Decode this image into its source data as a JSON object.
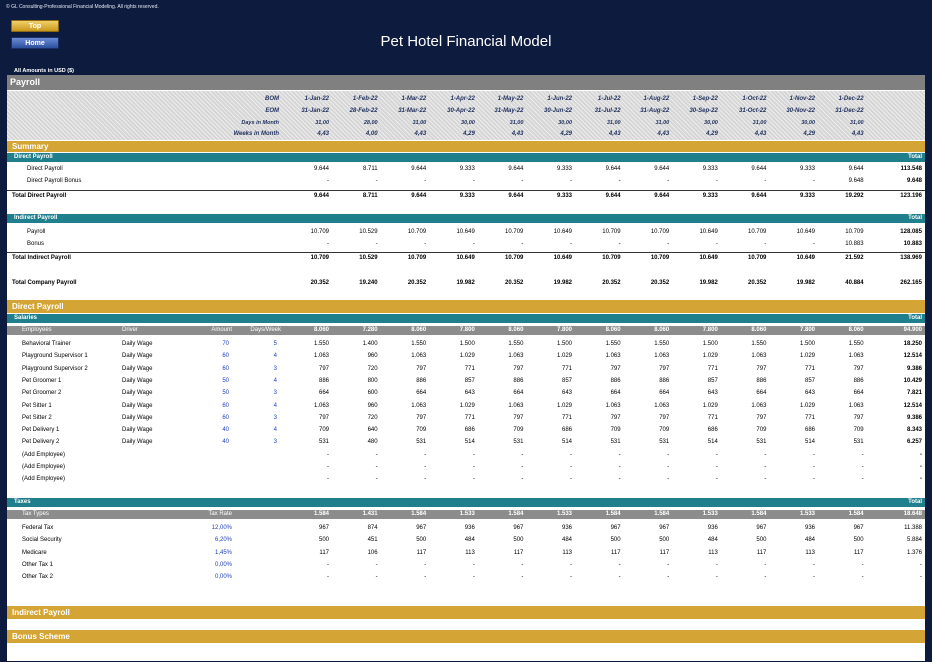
{
  "header": {
    "copyright": "© GL Consulting-Professional Financial Modeling. All rights reserved.",
    "top_button": "Top",
    "home_button": "Home",
    "title": "Pet Hotel Financial Model",
    "amounts": "All Amounts in  USD ($)"
  },
  "section_title": "Payroll",
  "timeline": {
    "bom_label": "BOM",
    "eom_label": "EOM",
    "days_label": "Days in Month",
    "weeks_label": "Weeks in Month",
    "bom": [
      "1-Jan-22",
      "1-Feb-22",
      "1-Mar-22",
      "1-Apr-22",
      "1-May-22",
      "1-Jun-22",
      "1-Jul-22",
      "1-Aug-22",
      "1-Sep-22",
      "1-Oct-22",
      "1-Nov-22",
      "1-Dec-22"
    ],
    "eom": [
      "31-Jan-22",
      "28-Feb-22",
      "31-Mar-22",
      "30-Apr-22",
      "31-May-22",
      "30-Jun-22",
      "31-Jul-22",
      "31-Aug-22",
      "30-Sep-22",
      "31-Oct-22",
      "30-Nov-22",
      "31-Dec-22"
    ],
    "days": [
      "31,00",
      "28,00",
      "31,00",
      "30,00",
      "31,00",
      "30,00",
      "31,00",
      "31,00",
      "30,00",
      "31,00",
      "30,00",
      "31,00"
    ],
    "weeks": [
      "4,43",
      "4,00",
      "4,43",
      "4,29",
      "4,43",
      "4,29",
      "4,43",
      "4,43",
      "4,29",
      "4,43",
      "4,29",
      "4,43"
    ]
  },
  "summary": {
    "title": "Summary",
    "direct_title": "Direct Payroll",
    "total_label": "Total",
    "direct_rows": [
      {
        "label": "Direct Payroll",
        "values": [
          "9.644",
          "8.711",
          "9.644",
          "9.333",
          "9.644",
          "9.333",
          "9.644",
          "9.644",
          "9.333",
          "9.644",
          "9.333",
          "9.644"
        ],
        "total": "113.548"
      },
      {
        "label": "Direct Payroll Bonus",
        "values": [
          "-",
          "-",
          "-",
          "-",
          "-",
          "-",
          "-",
          "-",
          "-",
          "-",
          "-",
          "9.648"
        ],
        "total": "9.648"
      }
    ],
    "direct_total": {
      "label": "Total Direct Payroll",
      "values": [
        "9.644",
        "8.711",
        "9.644",
        "9.333",
        "9.644",
        "9.333",
        "9.644",
        "9.644",
        "9.333",
        "9.644",
        "9.333",
        "19.292"
      ],
      "total": "123.196"
    },
    "indirect_title": "Indirect Payroll",
    "indirect_rows": [
      {
        "label": "Payroll",
        "values": [
          "10.709",
          "10.529",
          "10.709",
          "10.649",
          "10.709",
          "10.649",
          "10.709",
          "10.709",
          "10.649",
          "10.709",
          "10.649",
          "10.709"
        ],
        "total": "128.085"
      },
      {
        "label": "Bonus",
        "values": [
          "-",
          "-",
          "-",
          "-",
          "-",
          "-",
          "-",
          "-",
          "-",
          "-",
          "-",
          "10.883"
        ],
        "total": "10.883"
      }
    ],
    "indirect_total": {
      "label": "Total Indirect Payroll",
      "values": [
        "10.709",
        "10.529",
        "10.709",
        "10.649",
        "10.709",
        "10.649",
        "10.709",
        "10.709",
        "10.649",
        "10.709",
        "10.649",
        "21.592"
      ],
      "total": "138.969"
    },
    "company_total": {
      "label": "Total Company Payroll",
      "values": [
        "20.352",
        "19.240",
        "20.352",
        "19.982",
        "20.352",
        "19.982",
        "20.352",
        "20.352",
        "19.982",
        "20.352",
        "19.982",
        "40.884"
      ],
      "total": "262.165"
    }
  },
  "direct_payroll": {
    "title": "Direct Payroll",
    "salaries_title": "Salaries",
    "total_label": "Total",
    "columns": {
      "employees": "Employees",
      "driver": "Driver",
      "amount": "Amount",
      "days_week": "Days/Week"
    },
    "header_values": [
      "8.060",
      "7.280",
      "8.060",
      "7.800",
      "8.060",
      "7.800",
      "8.060",
      "8.060",
      "7.800",
      "8.060",
      "7.800",
      "8.060"
    ],
    "header_total": "94.900",
    "employees": [
      {
        "name": "Behavioral Trainer",
        "driver": "Daily Wage",
        "amount": "70",
        "days": "5",
        "values": [
          "1.550",
          "1.400",
          "1.550",
          "1.500",
          "1.550",
          "1.500",
          "1.550",
          "1.550",
          "1.500",
          "1.550",
          "1.500",
          "1.550"
        ],
        "total": "18.250"
      },
      {
        "name": "Playground Supervisor 1",
        "driver": "Daily Wage",
        "amount": "60",
        "days": "4",
        "values": [
          "1.063",
          "960",
          "1.063",
          "1.029",
          "1.063",
          "1.029",
          "1.063",
          "1.063",
          "1.029",
          "1.063",
          "1.029",
          "1.063"
        ],
        "total": "12.514"
      },
      {
        "name": "Playground Supervisor 2",
        "driver": "Daily Wage",
        "amount": "60",
        "days": "3",
        "values": [
          "797",
          "720",
          "797",
          "771",
          "797",
          "771",
          "797",
          "797",
          "771",
          "797",
          "771",
          "797"
        ],
        "total": "9.386"
      },
      {
        "name": "Pet Groomer 1",
        "driver": "Daily Wage",
        "amount": "50",
        "days": "4",
        "values": [
          "886",
          "800",
          "886",
          "857",
          "886",
          "857",
          "886",
          "886",
          "857",
          "886",
          "857",
          "886"
        ],
        "total": "10.429"
      },
      {
        "name": "Pet Groomer 2",
        "driver": "Daily Wage",
        "amount": "50",
        "days": "3",
        "values": [
          "664",
          "600",
          "664",
          "643",
          "664",
          "643",
          "664",
          "664",
          "643",
          "664",
          "643",
          "664"
        ],
        "total": "7.821"
      },
      {
        "name": "Pet Sitter 1",
        "driver": "Daily Wage",
        "amount": "60",
        "days": "4",
        "values": [
          "1.063",
          "960",
          "1.063",
          "1.029",
          "1.063",
          "1.029",
          "1.063",
          "1.063",
          "1.029",
          "1.063",
          "1.029",
          "1.063"
        ],
        "total": "12.514"
      },
      {
        "name": "Pet Sitter 2",
        "driver": "Daily Wage",
        "amount": "60",
        "days": "3",
        "values": [
          "797",
          "720",
          "797",
          "771",
          "797",
          "771",
          "797",
          "797",
          "771",
          "797",
          "771",
          "797"
        ],
        "total": "9.386"
      },
      {
        "name": "Pet Delivery 1",
        "driver": "Daily Wage",
        "amount": "40",
        "days": "4",
        "values": [
          "709",
          "640",
          "709",
          "686",
          "709",
          "686",
          "709",
          "709",
          "686",
          "709",
          "686",
          "709"
        ],
        "total": "8.343"
      },
      {
        "name": "Pet Delivery 2",
        "driver": "Daily Wage",
        "amount": "40",
        "days": "3",
        "values": [
          "531",
          "480",
          "531",
          "514",
          "531",
          "514",
          "531",
          "531",
          "514",
          "531",
          "514",
          "531"
        ],
        "total": "6.257"
      },
      {
        "name": "(Add Employee)",
        "driver": "",
        "amount": "",
        "days": "",
        "values": [
          "-",
          "-",
          "-",
          "-",
          "-",
          "-",
          "-",
          "-",
          "-",
          "-",
          "-",
          "-"
        ],
        "total": "-"
      },
      {
        "name": "(Add Employee)",
        "driver": "",
        "amount": "",
        "days": "",
        "values": [
          "-",
          "-",
          "-",
          "-",
          "-",
          "-",
          "-",
          "-",
          "-",
          "-",
          "-",
          "-"
        ],
        "total": "-"
      },
      {
        "name": "(Add Employee)",
        "driver": "",
        "amount": "",
        "days": "",
        "values": [
          "-",
          "-",
          "-",
          "-",
          "-",
          "-",
          "-",
          "-",
          "-",
          "-",
          "-",
          "-"
        ],
        "total": "-"
      }
    ],
    "taxes_title": "Taxes",
    "tax_columns": {
      "types": "Tax Types",
      "rate": "Tax Rate"
    },
    "tax_header_values": [
      "1.584",
      "1.431",
      "1.584",
      "1.533",
      "1.584",
      "1.533",
      "1.584",
      "1.584",
      "1.533",
      "1.584",
      "1.533",
      "1.584"
    ],
    "tax_header_total": "18.648",
    "taxes": [
      {
        "name": "Federal Tax",
        "rate": "12,00%",
        "values": [
          "967",
          "874",
          "967",
          "936",
          "967",
          "936",
          "967",
          "967",
          "936",
          "967",
          "936",
          "967"
        ],
        "total": "11.388"
      },
      {
        "name": "Social Security",
        "rate": "6,20%",
        "values": [
          "500",
          "451",
          "500",
          "484",
          "500",
          "484",
          "500",
          "500",
          "484",
          "500",
          "484",
          "500"
        ],
        "total": "5.884"
      },
      {
        "name": "Medicare",
        "rate": "1,45%",
        "values": [
          "117",
          "106",
          "117",
          "113",
          "117",
          "113",
          "117",
          "117",
          "113",
          "117",
          "113",
          "117"
        ],
        "total": "1.376"
      },
      {
        "name": "Other Tax 1",
        "rate": "0,00%",
        "values": [
          "-",
          "-",
          "-",
          "-",
          "-",
          "-",
          "-",
          "-",
          "-",
          "-",
          "-",
          "-"
        ],
        "total": "-"
      },
      {
        "name": "Other Tax 2",
        "rate": "0,00%",
        "values": [
          "-",
          "-",
          "-",
          "-",
          "-",
          "-",
          "-",
          "-",
          "-",
          "-",
          "-",
          "-"
        ],
        "total": "-"
      }
    ]
  },
  "indirect_payroll_title": "Indirect Payroll",
  "bonus_scheme_title": "Bonus Scheme"
}
